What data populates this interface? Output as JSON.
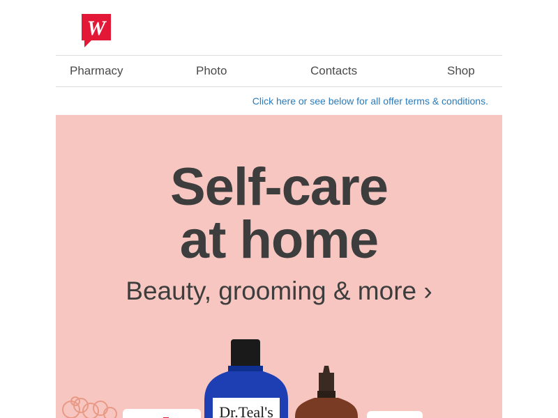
{
  "brand": {
    "logo_letter": "W",
    "color": "#e31837"
  },
  "nav": {
    "items": [
      {
        "label": "Pharmacy"
      },
      {
        "label": "Photo"
      },
      {
        "label": "Contacts"
      },
      {
        "label": "Shop"
      }
    ]
  },
  "terms_link": "Click here or see below for all offer terms & conditions.",
  "hero": {
    "line1": "Self-care",
    "line2": "at home",
    "subline": "Beauty, grooming & more ›",
    "background": "#f7c6c1",
    "product_label": "Dr.Teal's"
  }
}
